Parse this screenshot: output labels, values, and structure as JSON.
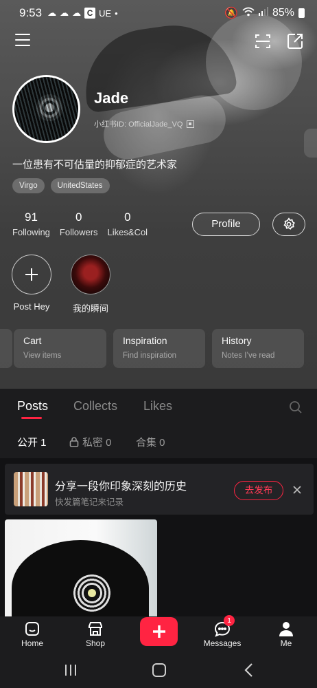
{
  "status_bar": {
    "time": "9:53",
    "carrier_box": "C",
    "carrier_text": "UE",
    "battery": "85%"
  },
  "profile": {
    "name": "Jade",
    "id_text": "小红书ID: OfficialJade_VQ",
    "bio": "一位患有不可估量的抑郁症的艺术家",
    "tags": [
      "Virgo",
      "UnitedStates"
    ],
    "stats": [
      {
        "value": "91",
        "label": "Following"
      },
      {
        "value": "0",
        "label": "Followers"
      },
      {
        "value": "0",
        "label": "Likes&Col"
      }
    ],
    "profile_button": "Profile"
  },
  "stories": [
    {
      "label": "Post Hey"
    },
    {
      "label": "我的瞬间"
    }
  ],
  "cards": [
    {
      "title": "Cart",
      "subtitle": "View items"
    },
    {
      "title": "Inspiration",
      "subtitle": "Find inspiration"
    },
    {
      "title": "History",
      "subtitle": "Notes I’ve read"
    }
  ],
  "tabs": [
    "Posts",
    "Collects",
    "Likes"
  ],
  "subtabs": [
    "公开 1",
    "私密 0",
    "合集 0"
  ],
  "banner": {
    "title": "分享一段你印象深刻的历史",
    "subtitle": "快发篇笔记来记录",
    "button": "去发布"
  },
  "bottom_nav": {
    "home": "Home",
    "shop": "Shop",
    "messages": "Messages",
    "messages_badge": "1",
    "me": "Me"
  },
  "colors": {
    "accent": "#ff2442",
    "background": "#1a1a1c"
  }
}
